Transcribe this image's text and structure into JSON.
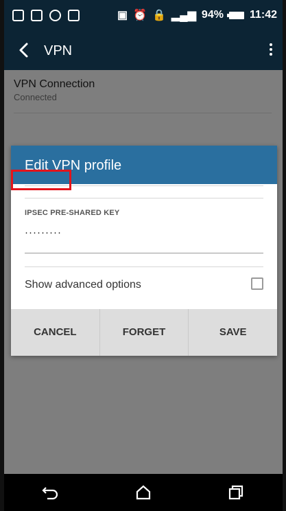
{
  "status_bar": {
    "battery": "94%",
    "time": "11:42"
  },
  "app_bar": {
    "title": "VPN"
  },
  "vpn_list": {
    "items": [
      {
        "name": "VPN Connection",
        "status": "Connected"
      }
    ]
  },
  "dialog": {
    "title": "Edit VPN profile",
    "ipsec_label": "IPSEC PRE-SHARED KEY",
    "ipsec_value": "·········",
    "advanced_label": "Show advanced options",
    "advanced_checked": false,
    "buttons": {
      "cancel": "CANCEL",
      "forget": "FORGET",
      "save": "SAVE"
    }
  },
  "colors": {
    "header_bg": "#0c2434",
    "dialog_header": "#2a6f9f",
    "highlight": "#e4141b",
    "scrim": "#7e7e7e"
  }
}
